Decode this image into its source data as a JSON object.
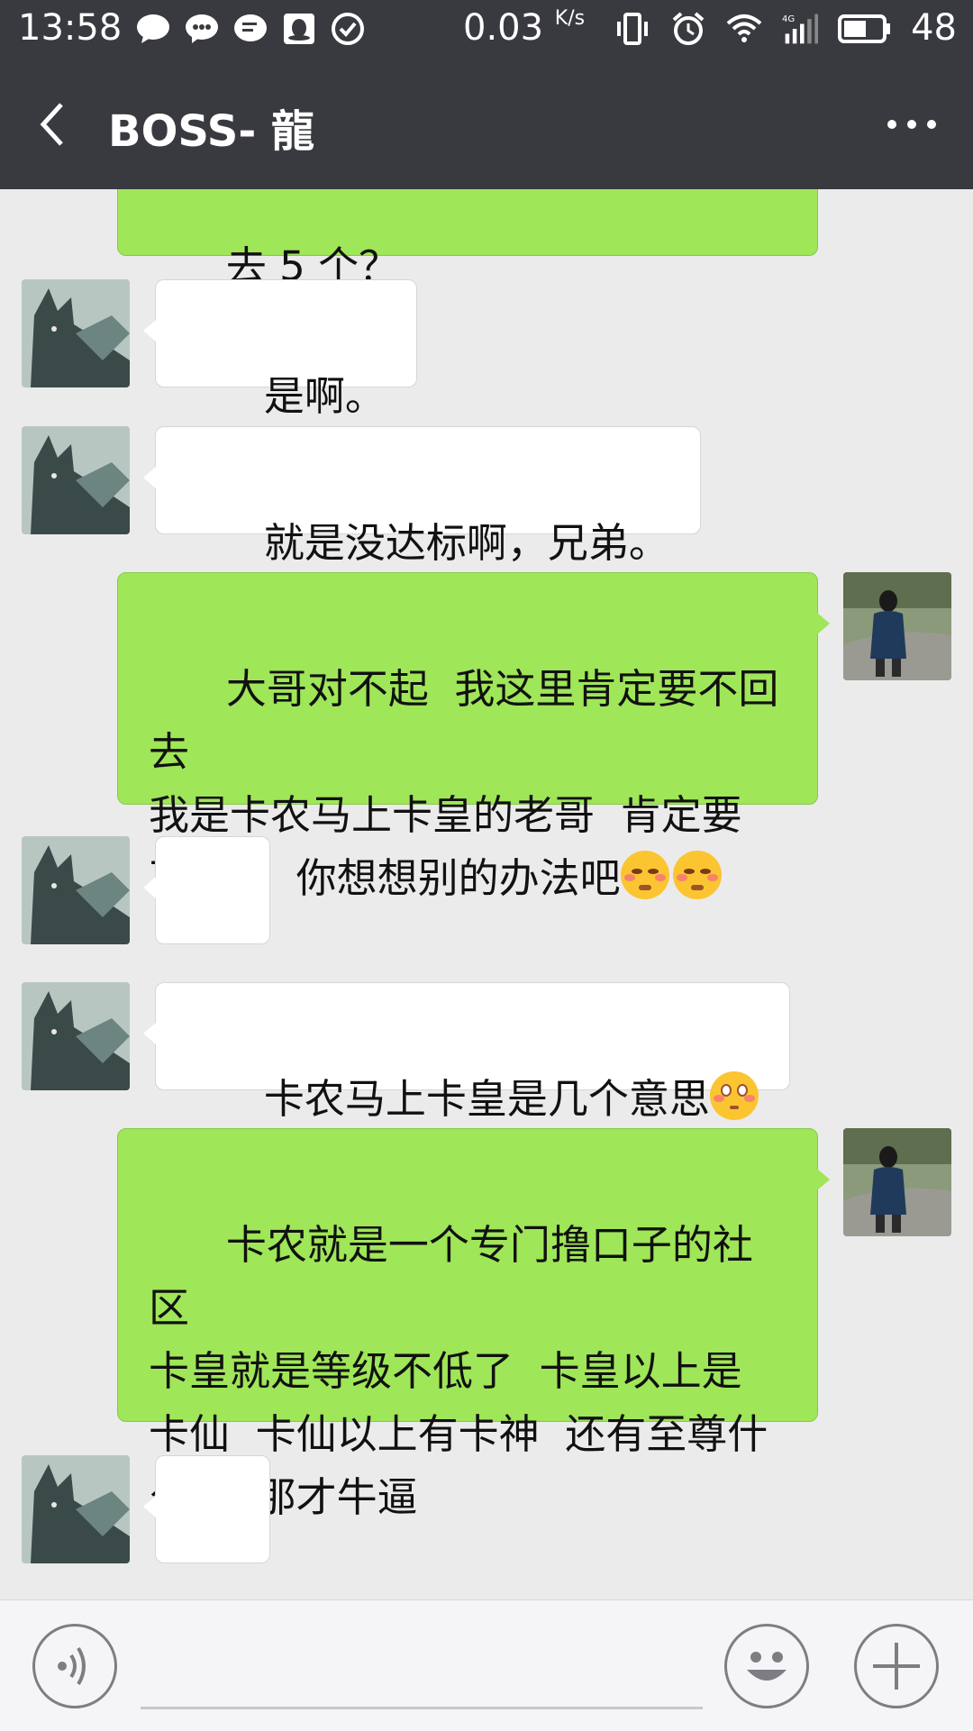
{
  "status_bar": {
    "time": "13:58",
    "net_speed": "0.03",
    "net_unit": "K/s",
    "battery": "48",
    "icons_left": [
      "chat-icon",
      "message-icon",
      "chat-bubble-icon",
      "qq-icon",
      "check-icon"
    ],
    "icons_right": [
      "vibrate-icon",
      "alarm-icon",
      "wifi-icon",
      "signal-4g-icon",
      "battery-icon"
    ]
  },
  "header": {
    "title": "BOSS- 龍"
  },
  "messages": [
    {
      "side": "right",
      "text": "去 5 个？",
      "partial": true
    },
    {
      "side": "left",
      "text": "是啊。"
    },
    {
      "side": "left",
      "text": "就是没达标啊，兄弟。"
    },
    {
      "side": "right",
      "text": "大哥对不起  我这里肯定要不回去\n我是卡农马上卡皇的老哥  肯定要\n不回去  你想想别的办法吧",
      "emojis": 2
    },
    {
      "side": "left",
      "text": "",
      "emoji_only": true
    },
    {
      "side": "left",
      "text": "卡农马上卡皇是几个意思",
      "emojis": 1
    },
    {
      "side": "right",
      "text": "卡农就是一个专门撸口子的社区\n卡皇就是等级不低了  卡皇以上是\n卡仙  卡仙以上有卡神  还有至尊什\n么的  那才牛逼"
    },
    {
      "side": "left",
      "text": "- -"
    }
  ],
  "colors": {
    "header_bg": "#393a3f",
    "chat_bg": "#ebebeb",
    "green_bubble": "#9fe658",
    "white_bubble": "#ffffff"
  }
}
